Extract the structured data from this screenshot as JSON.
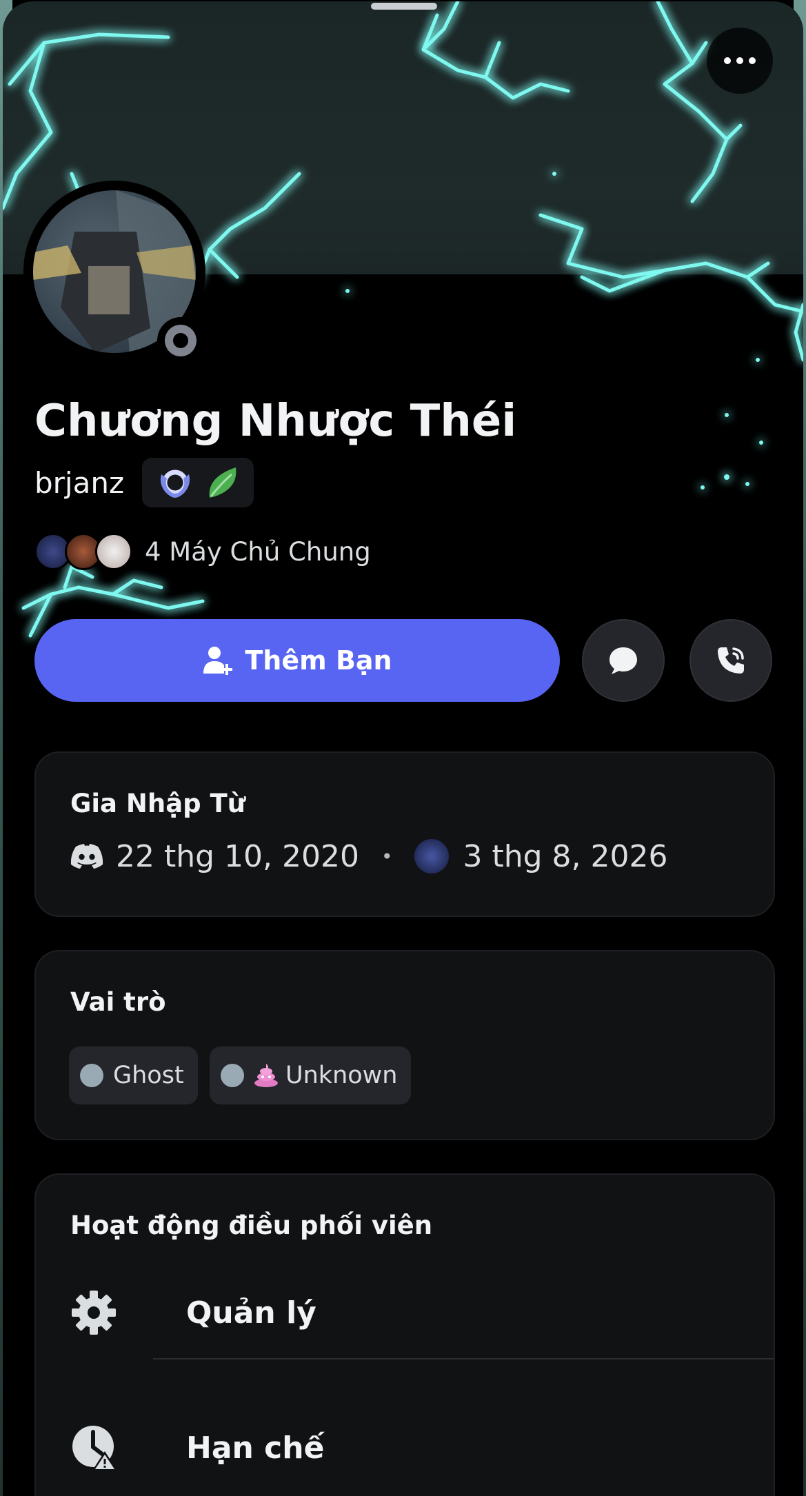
{
  "profile": {
    "display_name": "Chương Nhược Théi",
    "username": "brjanz",
    "badges": [
      "hypesquad-brilliance-icon",
      "leaf-badge-icon"
    ],
    "status": "offline"
  },
  "mutual": {
    "text": "4 Máy Chủ Chung"
  },
  "actions": {
    "add_friend_label": "Thêm Bạn"
  },
  "member_since": {
    "title": "Gia Nhập Từ",
    "discord_date": "22 thg 10, 2020",
    "separator": "•",
    "server_date": "3 thg 8, 2026"
  },
  "roles": {
    "title": "Vai trò",
    "items": [
      {
        "label": "Ghost",
        "color": "#99aab5"
      },
      {
        "label": "Unknown",
        "color": "#99aab5",
        "emoji": "💩"
      }
    ]
  },
  "moderation": {
    "title": "Hoạt động điều phối viên",
    "items": [
      {
        "label": "Quản lý",
        "icon": "gear-icon"
      },
      {
        "label": "Hạn chế",
        "icon": "timeout-clock-icon"
      }
    ]
  },
  "colors": {
    "accent": "#5865f2",
    "lightning": "#7ff8f0",
    "card_bg": "#111214"
  }
}
